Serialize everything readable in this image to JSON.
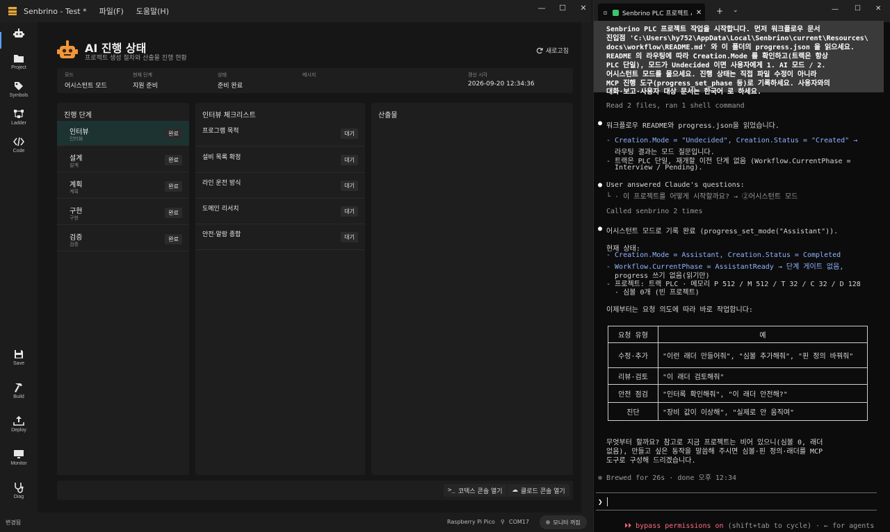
{
  "app": {
    "title": "Senbrino - Test *",
    "menus": [
      "파일(F)",
      "도움말(H)"
    ],
    "window_controls": [
      "—",
      "☐",
      "✕"
    ]
  },
  "rail": [
    {
      "label": "",
      "icon": "robot-icon"
    },
    {
      "label": "Project",
      "icon": "folder-icon"
    },
    {
      "label": "Symbols",
      "icon": "tag-icon"
    },
    {
      "label": "Ladder",
      "icon": "ladder-icon"
    },
    {
      "label": "Code",
      "icon": "code-icon"
    },
    {
      "label": "Save",
      "icon": "save-icon"
    },
    {
      "label": "Build",
      "icon": "hammer-icon"
    },
    {
      "label": "Deploy",
      "icon": "upload-icon"
    },
    {
      "label": "Monitor",
      "icon": "monitor-icon"
    },
    {
      "label": "Diag",
      "icon": "stethoscope-icon"
    }
  ],
  "header": {
    "title": "AI 진행 상태",
    "subtitle": "프로젝트 생성 절차와 산출물 진행 현황",
    "refresh_label": "새로고침"
  },
  "info": {
    "mode_key": "모드",
    "mode_val": "어시스턴트 모드",
    "phase_key": "현재 단계",
    "phase_val": "지원 준비",
    "state_key": "상태",
    "state_val": "준비 완료",
    "msg_key": "메시지",
    "msg_val": "",
    "time_key": "갱신 시각",
    "time_val": "2026-09-20 12:34:36"
  },
  "stages": {
    "title": "진행 단계",
    "items": [
      {
        "name": "인터뷰",
        "sub": "인터뷰",
        "status": "완료"
      },
      {
        "name": "설계",
        "sub": "설계",
        "status": "완료"
      },
      {
        "name": "계획",
        "sub": "계획",
        "status": "완료"
      },
      {
        "name": "구현",
        "sub": "구현",
        "status": "완료"
      },
      {
        "name": "검증",
        "sub": "검증",
        "status": "완료"
      }
    ]
  },
  "checklist": {
    "title": "인터뷰 체크리스트",
    "items": [
      {
        "name": "프로그램 목적",
        "status": "대기"
      },
      {
        "name": "설비 목록 확정",
        "status": "대기"
      },
      {
        "name": "라인 운전 방식",
        "status": "대기"
      },
      {
        "name": "도메인 리서치",
        "status": "대기"
      },
      {
        "name": "안전·알람 종합",
        "status": "대기"
      }
    ]
  },
  "artifacts": {
    "title": "산출물"
  },
  "console_buttons": {
    "codex": "코덱스 콘솔 열기",
    "claude": "클로드 콘솔 열기"
  },
  "statusbar": {
    "left": "변경됨",
    "board": "Raspberry Pi Pico",
    "port": "COM17",
    "monitor": "모니터 꺼짐"
  },
  "terminal": {
    "tab_title": "Senbrino PLC 프로젝트 AI",
    "prompt_lines": [
      "Senbrino PLC 프로젝트 작업을 시작합니다. 먼저 워크플로우 문서",
      "진입점 'C:\\Users\\hy752\\AppData\\Local\\Senbrino\\current\\Resources\\",
      "docs\\workflow\\README.md' 와 이 폴더의 progress.json 을 읽으세요.",
      "README 의 라우팅에 따라 Creation.Mode 를 확인하고(트랙은 항상",
      "PLC 단일), 모드가 Undecided 이면 사용자에게 1. AI 모드 / 2.",
      "어시스턴트 모드를 물으세요. 진행 상태는 직접 파일 수정이 아니라",
      "MCP 진행 도구(progress_set_phase 등)로 기록하세요. 사용자와의",
      "대화·보고·사용자 대상 문서는 한국어 로 하세요."
    ],
    "read_line": "Read 2 files, ran 1 shell command",
    "b1": "워크플로우 README와 progress.json을 읽었습니다.",
    "b1_l1a": "- Creation.Mode = \"Undecided\", Creation.Status = \"Created\" →",
    "b1_l1b": "  라우팅 결과는 모드 질문입니다.",
    "b1_l2a": "- 트랙은 PLC 단일, 재개할 이전 단계 없음 (Workflow.CurrentPhase =",
    "b1_l2b": "  Interview / Pending).",
    "b2": "User answered Claude's questions:",
    "b2_l1": "└ · 이 프로젝트를 어떻게 시작할까요? → ②어시스턴트 모드",
    "called_line": "Called senbrino 2 times",
    "b3": "어시스턴트 모드로 기록 완료 (progress_set_mode(\"Assistant\")).",
    "state_head": "현재 상태:",
    "s1": "- Creation.Mode = Assistant, Creation.Status = Completed",
    "s2a": "- Workflow.CurrentPhase = AssistantReady → 단계 게이트 없음,",
    "s2b": "  progress 쓰기 없음(읽기만)",
    "s3a": "- 프로젝트: 트랙 PLC · 메모리 P 512 / M 512 / T 32 / C 32 / D 128",
    "s3b": "  · 심볼 0개 (빈 프로젝트)",
    "now_line": "이제부터는 요청 의도에 따라 바로 작업합니다:",
    "table": {
      "headers": [
        "요청 유형",
        "예"
      ],
      "rows": [
        [
          "수정·추가",
          "\"이런 래더 만들어줘\", \"심볼 추가해줘\", \"핀 정의 바꿔줘\""
        ],
        [
          "리뷰·검토",
          "\"이 래더 검토해줘\""
        ],
        [
          "안전 점검",
          "\"인터록 확인해줘\", \"이 래더 안전해?\""
        ],
        [
          "진단",
          "\"장비 값이 이상해\", \"실제로 안 움직여\""
        ]
      ]
    },
    "closing_lines": [
      "무엇부터 할까요? 참고로 지금 프로젝트는 비어 있으니(심볼 0, 래더",
      "없음), 만들고 싶은 동작을 말씀해 주시면 심볼·핀 정의·래더를 MCP",
      "도구로 구성해 드리겠습니다."
    ],
    "brewed": "✻ Brewed for 26s · done 오후 12:34",
    "prompt_char": "❯",
    "bypass_a": "⏵⏵ bypass permissions on",
    "bypass_b": " (shift+tab to cycle) · ← for agents"
  },
  "colors": {
    "accent": "#5aa0ff",
    "active_stage": "#1d3331",
    "bypass": "#ff6b81",
    "code_blue": "#8fb4ff"
  }
}
